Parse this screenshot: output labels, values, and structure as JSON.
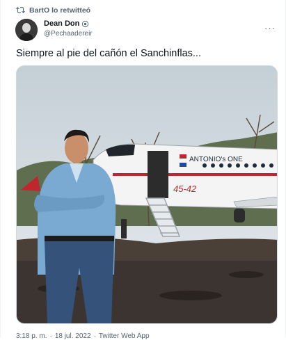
{
  "retweet": {
    "label": "BartO lo retwitteó",
    "icon": "retweet-icon"
  },
  "author": {
    "name": "Dean Don",
    "handle": "@Pechaadereir",
    "verified_icon": "verified-badge-icon"
  },
  "more_label": "···",
  "tweet": {
    "text": "Siempre al pie del cañón el Sanchinflas..."
  },
  "media": {
    "plane_name": "ANTONIO's ONE",
    "plane_reg": "45-42"
  },
  "meta": {
    "time": "3:18 p. m.",
    "sep": "·",
    "date": "18 jul. 2022",
    "sep2": "·",
    "source": "Twitter Web App"
  },
  "colors": {
    "accent": "#1d9bf0",
    "text": "#0f1419",
    "muted": "#536471"
  }
}
